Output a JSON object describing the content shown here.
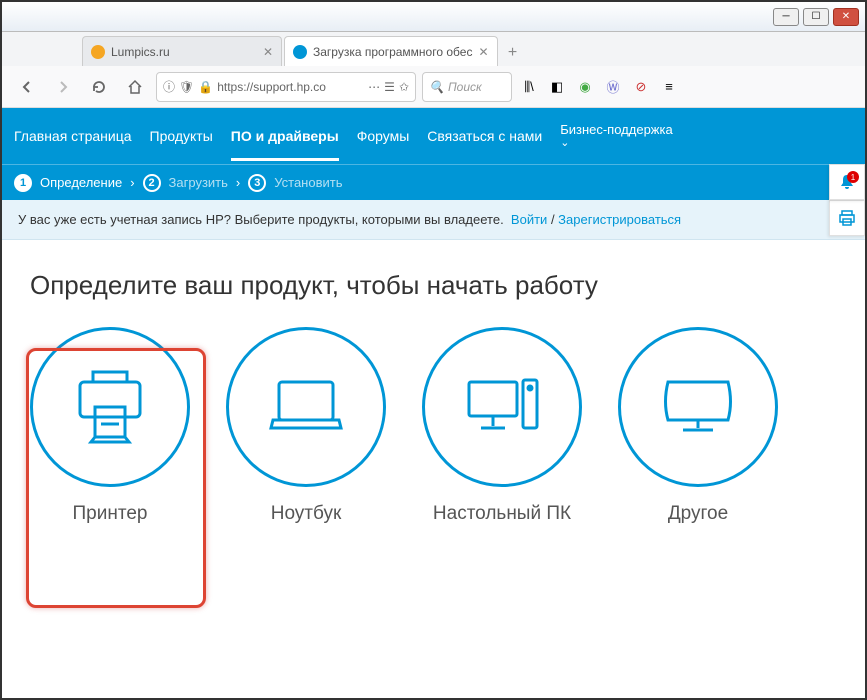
{
  "window": {
    "tabs": [
      {
        "title": "Lumpics.ru",
        "favicon_color": "#f5a623"
      },
      {
        "title": "Загрузка программного обес",
        "favicon_color": "#0096d6"
      }
    ],
    "url_display": "https://support.hp.co",
    "search_placeholder": "Поиск"
  },
  "nav": {
    "items": [
      "Главная страница",
      "Продукты",
      "ПО и драйверы",
      "Форумы",
      "Связаться с нами"
    ],
    "active_index": 2,
    "business": "Бизнес-поддержка"
  },
  "steps": {
    "items": [
      {
        "num": "1",
        "label": "Определение",
        "active": true
      },
      {
        "num": "2",
        "label": "Загрузить",
        "active": false
      },
      {
        "num": "3",
        "label": "Установить",
        "active": false
      }
    ]
  },
  "signin": {
    "prompt": "У вас уже есть учетная запись HP? Выберите продукты, которыми вы владеете.",
    "login": "Войти",
    "sep": " / ",
    "register": "Зарегистрироваться"
  },
  "content": {
    "heading": "Определите ваш продукт, чтобы начать работу",
    "products": [
      {
        "label": "Принтер",
        "icon": "printer"
      },
      {
        "label": "Ноутбук",
        "icon": "laptop"
      },
      {
        "label": "Настольный ПК",
        "icon": "desktop"
      },
      {
        "label": "Другое",
        "icon": "monitor"
      }
    ]
  },
  "notification_count": "1"
}
